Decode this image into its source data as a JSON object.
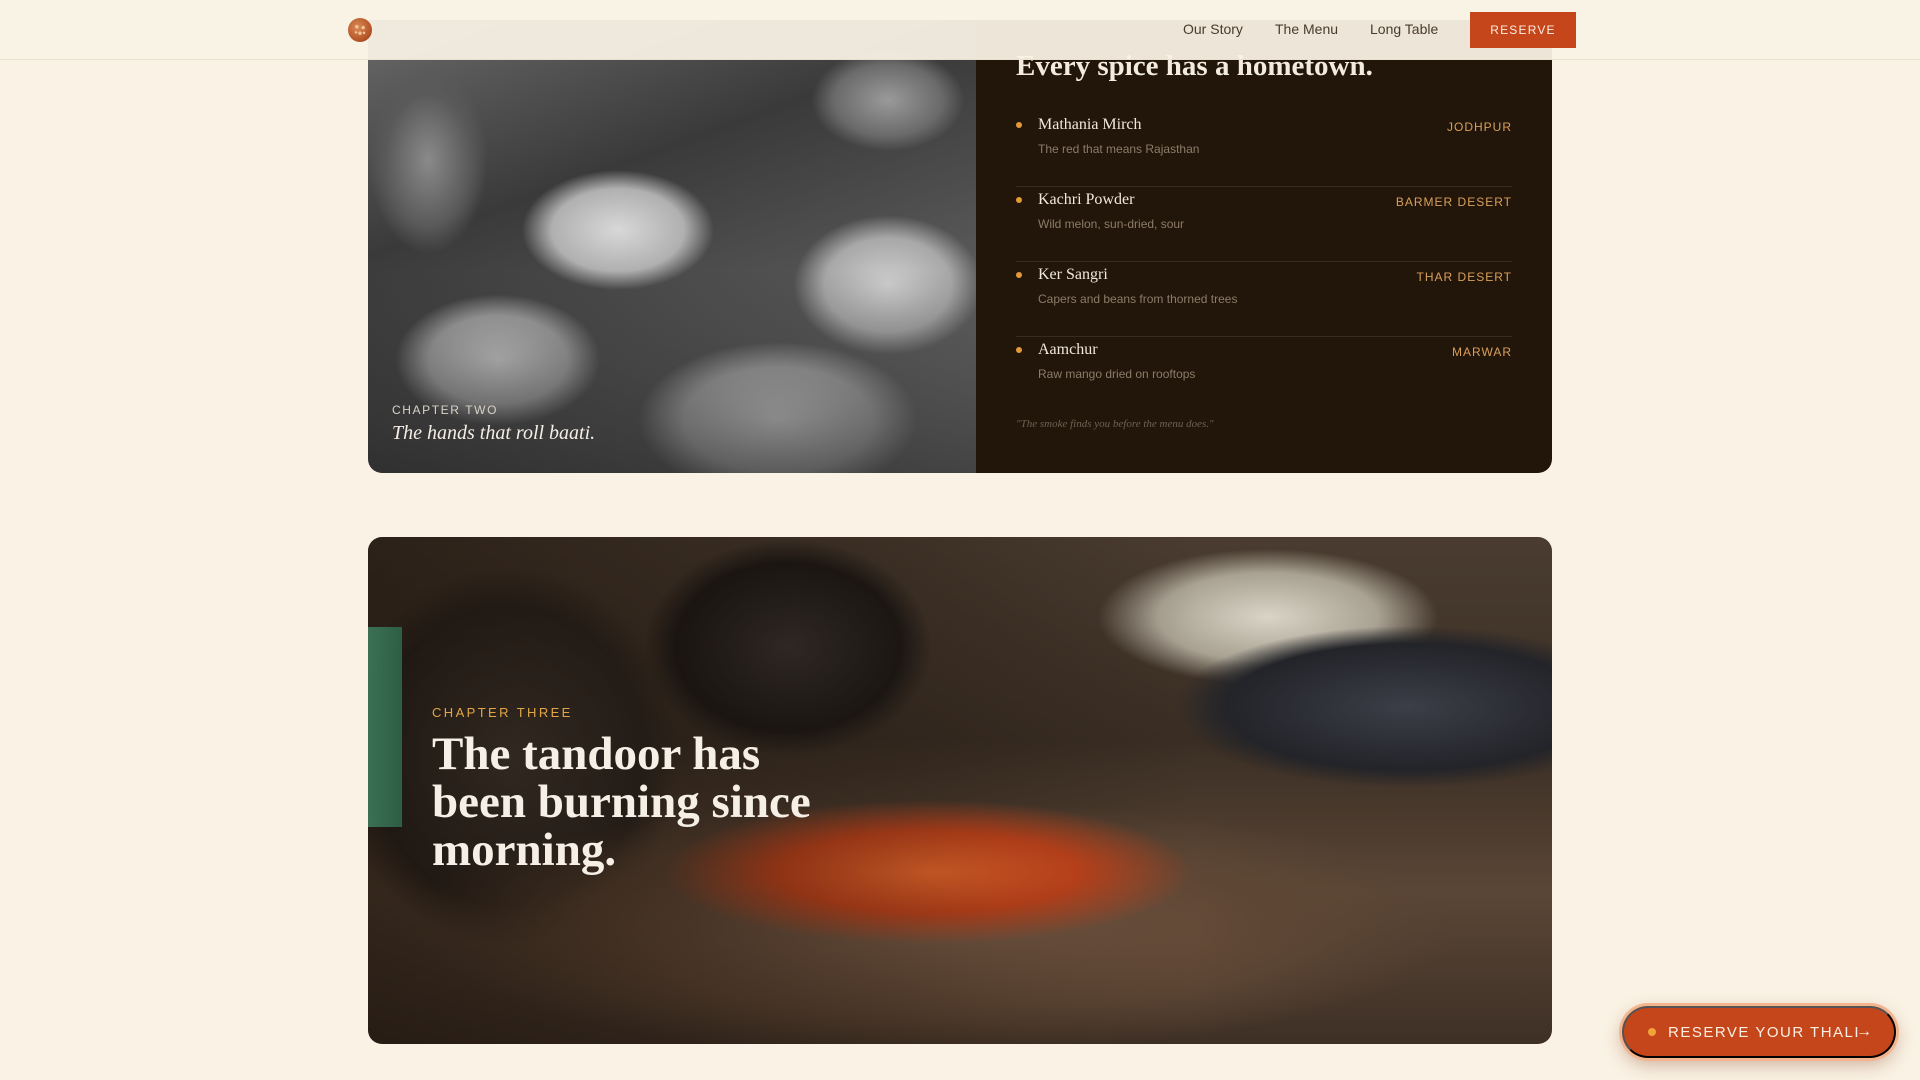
{
  "nav": {
    "links": [
      {
        "label": "Our Story"
      },
      {
        "label": "The Menu"
      },
      {
        "label": "Long Table"
      }
    ],
    "reserve_label": "RESERVE"
  },
  "chapter_two": {
    "eyebrow": "CHAPTER TWO",
    "title": "The hands that roll baati."
  },
  "spices": {
    "title": "Every spice has a hometown.",
    "items": [
      {
        "name": "Mathania Mirch",
        "desc": "The red that means Rajasthan",
        "origin": "JODHPUR"
      },
      {
        "name": "Kachri Powder",
        "desc": "Wild melon, sun-dried, sour",
        "origin": "BARMER DESERT"
      },
      {
        "name": "Ker Sangri",
        "desc": "Capers and beans from thorned trees",
        "origin": "THAR DESERT"
      },
      {
        "name": "Aamchur",
        "desc": "Raw mango dried on rooftops",
        "origin": "MARWAR"
      }
    ],
    "quote": "\"The smoke finds you before the menu does.\""
  },
  "chapter_three": {
    "eyebrow": "CHAPTER THREE",
    "title": "The tandoor has been burning since morning."
  },
  "cta": {
    "label": "RESERVE YOUR THALI",
    "arrow": "→"
  },
  "colors": {
    "accent": "#c4461a",
    "background": "#faf2e4",
    "panel": "#221509",
    "gold": "#d9a05a"
  }
}
